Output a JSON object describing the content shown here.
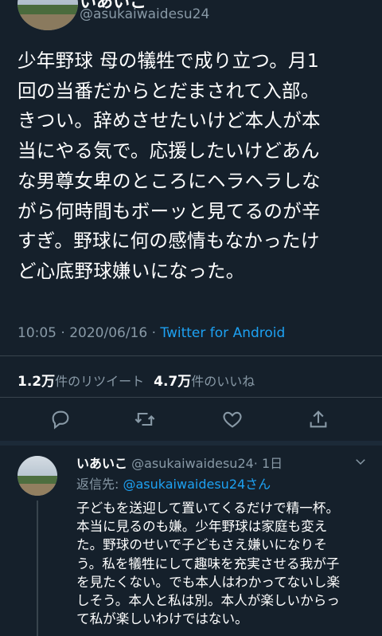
{
  "tweet": {
    "author_name": "いあいこ",
    "author_handle": "@asukaiwaidesu24",
    "body_lines": [
      "少年野球 母の犠牲で成り立つ。月1",
      "回の当番だからとだまされて入部。",
      "きつい。辞めさせたいけど本人が本",
      "当にやる気で。応援したいけどあん",
      "な男尊女卑のところにヘラヘラしな",
      "がら何時間もボーッと見てるのが辛",
      "すぎ。野球に何の感情もなかったけ",
      "ど心底野球嫌いになった。"
    ],
    "time": "10:05 · 2020/06/16 · ",
    "via": "Twitter for Android",
    "retweets_count": "1.2万",
    "retweets_label": "件のリツイート",
    "likes_count": "4.7万",
    "likes_label": "件のいいね",
    "actions": [
      "reply-icon",
      "retweet-icon",
      "like-icon",
      "share-icon"
    ]
  },
  "reply": {
    "author_name": "いあいこ",
    "author_handle": "@asukaiwaidesu24",
    "age": "· 1日",
    "reply_to_label": "返信先: ",
    "reply_to_mention": "@asukaiwaidesu24さん",
    "body_lines": [
      "子どもを送迎して置いてくるだけで精一杯。",
      "本当に見るのも嫌。少年野球は家庭も変え",
      "た。野球のせいで子どもさえ嫌いになりそ",
      "う。私を犠牲にして趣味を充実させる我が子",
      "を見たくない。でも本人はわかってないし楽",
      "しそう。本人と私は別。本人が楽しいからっ",
      "て私が楽しいわけではない。"
    ]
  },
  "colors": {
    "background": "#15202b",
    "text": "#ffffff",
    "muted": "#8899a6",
    "accent": "#1da1f2",
    "divider": "#38444d"
  }
}
